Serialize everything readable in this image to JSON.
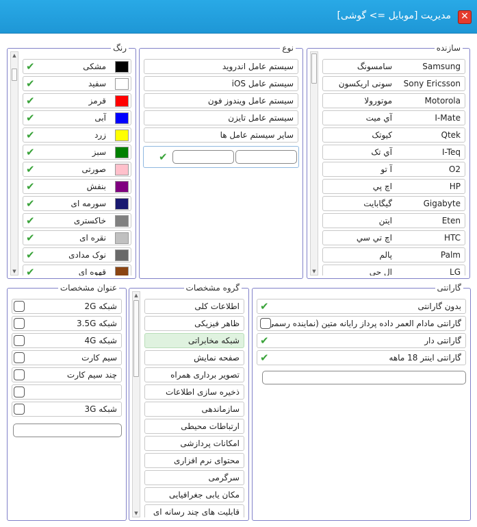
{
  "window": {
    "title": "مدیریت [موبایل => گوشی]",
    "close_icon": "close-icon"
  },
  "manufacturers": {
    "legend": "سازنده",
    "items": [
      {
        "en": "Samsung",
        "fa": "سامسونگ"
      },
      {
        "en": "Sony Ericsson",
        "fa": "سونی اریکسون"
      },
      {
        "en": "Motorola",
        "fa": "موتورولا"
      },
      {
        "en": "I-Mate",
        "fa": "آي ميت"
      },
      {
        "en": "Qtek",
        "fa": "کيوتک"
      },
      {
        "en": "I-Teq",
        "fa": "آي تک"
      },
      {
        "en": "O2",
        "fa": "آ تو"
      },
      {
        "en": "HP",
        "fa": "اچ پي"
      },
      {
        "en": "Gigabyte",
        "fa": "گيگابايت"
      },
      {
        "en": "Eten",
        "fa": "ايتن"
      },
      {
        "en": "HTC",
        "fa": "اچ تي سي"
      },
      {
        "en": "Palm",
        "fa": "پالم"
      },
      {
        "en": "LG",
        "fa": "ال جي"
      }
    ]
  },
  "types": {
    "legend": "نوع",
    "items": [
      "سیستم عامل اندروید",
      "سیستم عامل iOS",
      "سیستم عامل ویندوز فون",
      "سیستم عامل تایزن",
      "سایر سیستم عامل ها"
    ]
  },
  "colors": {
    "legend": "رنگ",
    "items": [
      {
        "name": "مشکی",
        "hex": "#000000"
      },
      {
        "name": "سفید",
        "hex": "#ffffff"
      },
      {
        "name": "قرمز",
        "hex": "#ff0000"
      },
      {
        "name": "آبی",
        "hex": "#0000ff"
      },
      {
        "name": "زرد",
        "hex": "#ffff00"
      },
      {
        "name": "سبز",
        "hex": "#008000"
      },
      {
        "name": "صورتی",
        "hex": "#ffc0cb"
      },
      {
        "name": "بنفش",
        "hex": "#800080"
      },
      {
        "name": "سورمه ای",
        "hex": "#191970"
      },
      {
        "name": "خاکستری",
        "hex": "#808080"
      },
      {
        "name": "نقره ای",
        "hex": "#c0c0c0"
      },
      {
        "name": "نوک مدادی",
        "hex": "#696969"
      },
      {
        "name": "قهوه ای",
        "hex": "#8b4513"
      }
    ]
  },
  "warranty": {
    "legend": "گارانتی",
    "items": [
      {
        "label": "بدون گارانتی",
        "checked": true
      },
      {
        "label": "گارانتی مادام العمر داده پرداز رایانه متین (نماینده رسمی)",
        "checked": false
      },
      {
        "label": "گارانتی دار",
        "checked": true
      },
      {
        "label": "گارانتی اینتر 18 ماهه",
        "checked": true
      }
    ]
  },
  "spec_groups": {
    "legend": "گروه مشخصات",
    "selected": "شبکه مخابراتی",
    "items": [
      "اطلاعات کلی",
      "ظاهر فیزیکی",
      "شبکه مخابراتی",
      "صفحه نمایش",
      "تصویر برداری همراه",
      "ذخیره سازی اطلاعات",
      "سازماندهی",
      "ارتباطات محیطی",
      "امکانات پردازشی",
      "محتوای نرم افزاری",
      "سرگرمی",
      "مکان یابی جغرافیایی",
      "قابلیت های چند رسانه ای"
    ]
  },
  "spec_titles": {
    "legend": "عنوان مشخصات",
    "items": [
      "شبکه 2G",
      "شبکه 3.5G",
      "شبکه 4G",
      "سیم کارت",
      "چند سیم کارت",
      "",
      "شبکه 3G"
    ]
  }
}
